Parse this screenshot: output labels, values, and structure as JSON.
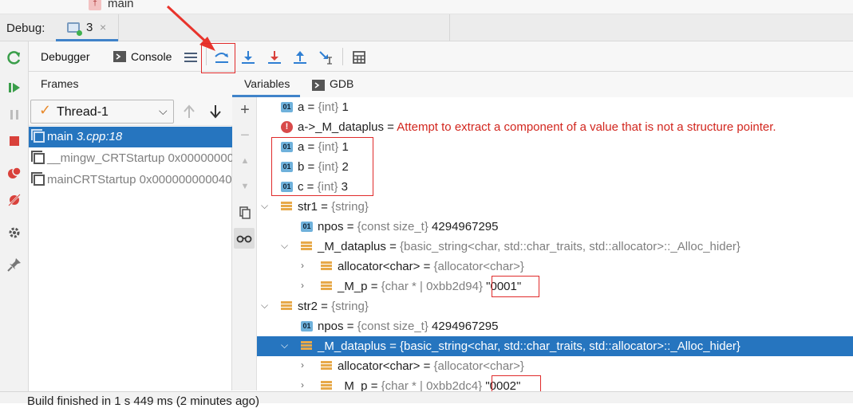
{
  "top_file": "main",
  "debug_tabs": {
    "label": "Debug:",
    "tab_name": "3",
    "close": "×"
  },
  "toolbar": {
    "debugger_label": "Debugger",
    "console_label": "Console",
    "icons": [
      "hamburger-icon",
      "show-execution-point-icon",
      "step-over-icon",
      "step-into-icon",
      "force-step-into-icon",
      "step-out-icon",
      "run-to-cursor-icon",
      "evaluate-expression-icon"
    ]
  },
  "frames": {
    "title": "Frames",
    "thread": "Thread-1",
    "items": [
      {
        "name": "main",
        "loc": "3.cpp:18"
      },
      {
        "name": "__mingw_CRTStartup",
        "loc": "0x00000000"
      },
      {
        "name": "mainCRTStartup",
        "loc": "0x000000000040"
      }
    ]
  },
  "variables": {
    "tabs": [
      "Variables",
      "GDB"
    ],
    "rows": [
      {
        "indent": 0,
        "icon": "01",
        "name": "a",
        "type": "{int}",
        "value": "1"
      },
      {
        "indent": 0,
        "icon": "error",
        "name": "a->_M_dataplus",
        "error": "Attempt to extract a component of a value that is not a structure pointer."
      },
      {
        "indent": 0,
        "icon": "01",
        "name": "a",
        "type": "{int}",
        "value": "1"
      },
      {
        "indent": 0,
        "icon": "01",
        "name": "b",
        "type": "{int}",
        "value": "2"
      },
      {
        "indent": 0,
        "icon": "01",
        "name": "c",
        "type": "{int}",
        "value": "3"
      },
      {
        "indent": 0,
        "icon": "stack",
        "expand": "v",
        "name": "str1",
        "type": "{string}",
        "value": ""
      },
      {
        "indent": 1,
        "icon": "01",
        "name": "npos",
        "type": "{const size_t}",
        "value": "4294967295"
      },
      {
        "indent": 1,
        "icon": "stack",
        "expand": "v",
        "name": "_M_dataplus",
        "type": "{basic_string<char, std::char_traits, std::allocator>::_Alloc_hider}",
        "value": ""
      },
      {
        "indent": 2,
        "icon": "stack",
        "expand": ">",
        "name": "allocator<char>",
        "type": "{allocator<char>}",
        "value": ""
      },
      {
        "indent": 2,
        "icon": "stack",
        "expand": ">",
        "name": "_M_p",
        "type": "{char * | 0xbb2d94}",
        "value": "\"0001\""
      },
      {
        "indent": 0,
        "icon": "stack",
        "expand": "v",
        "name": "str2",
        "type": "{string}",
        "value": ""
      },
      {
        "indent": 1,
        "icon": "01",
        "name": "npos",
        "type": "{const size_t}",
        "value": "4294967295"
      },
      {
        "indent": 1,
        "icon": "stack",
        "expand": "v",
        "name": "_M_dataplus",
        "type": "{basic_string<char, std::char_traits, std::allocator>::_Alloc_hider}",
        "value": "",
        "selected": true
      },
      {
        "indent": 2,
        "icon": "stack",
        "expand": ">",
        "name": "allocator<char>",
        "type": "{allocator<char>}",
        "value": ""
      },
      {
        "indent": 2,
        "icon": "stack",
        "expand": ">",
        "name": "_M_p",
        "type": "{char * | 0xbb2dc4}",
        "value": "\"0002\""
      }
    ]
  },
  "status": "Build finished in 1 s 449 ms (2 minutes ago)",
  "colors": {
    "accent": "#2675bf",
    "error_text": "#d2261e",
    "annotation": "#e02b2b"
  }
}
